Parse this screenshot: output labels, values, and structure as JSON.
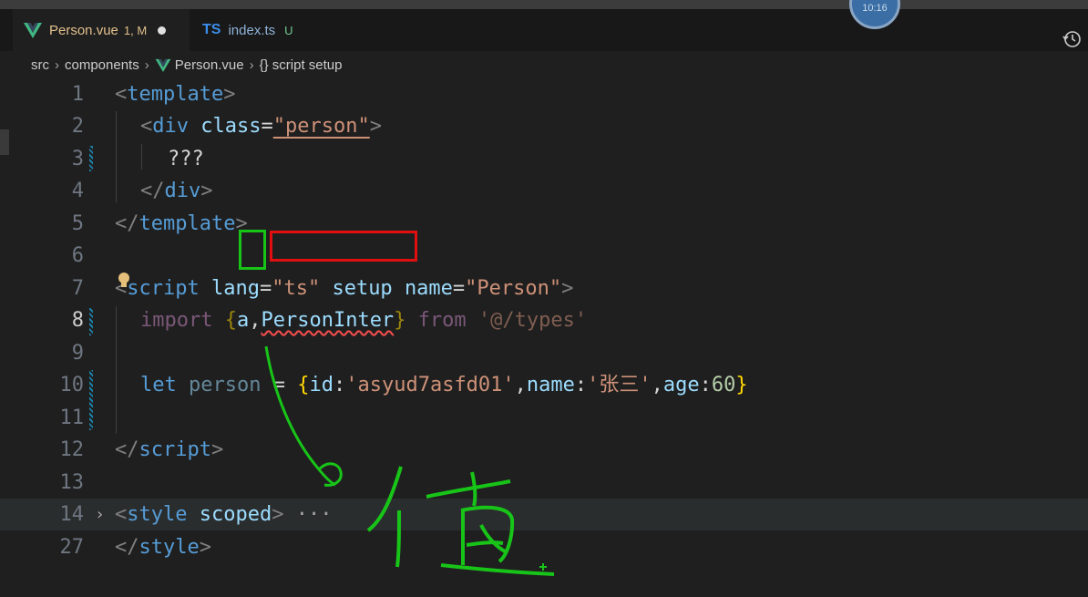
{
  "tabs": [
    {
      "label": "Person.vue",
      "status": "1, M",
      "active": true
    },
    {
      "label": "index.ts",
      "badge": "TS",
      "status": "U",
      "active": false
    }
  ],
  "clock_text": "10:16",
  "breadcrumb": {
    "part1": "src",
    "part2": "components",
    "part3": "Person.vue",
    "part4": "{} script setup"
  },
  "lines": [
    {
      "num": "1"
    },
    {
      "num": "2"
    },
    {
      "num": "3"
    },
    {
      "num": "4"
    },
    {
      "num": "5"
    },
    {
      "num": "6"
    },
    {
      "num": "7"
    },
    {
      "num": "8"
    },
    {
      "num": "9"
    },
    {
      "num": "10"
    },
    {
      "num": "11"
    },
    {
      "num": "12"
    },
    {
      "num": "13"
    },
    {
      "num": "14"
    },
    {
      "num": "27"
    }
  ],
  "code": {
    "l1": {
      "tag": "template"
    },
    "l2": {
      "tag": "div",
      "attr": "class",
      "value": "\"person\""
    },
    "l3": {
      "text": "???"
    },
    "l4": {
      "tag": "div"
    },
    "l5": {
      "tag": "template"
    },
    "l7": {
      "tag": "script",
      "attr1": "lang",
      "val1": "\"ts\"",
      "attr2": "setup",
      "attr3": "name",
      "val3": "\"Person\""
    },
    "l8": {
      "kw": "import",
      "ident1": "a",
      "ident2": "PersonInter",
      "from": "from",
      "path": "'@/types'"
    },
    "l10": {
      "kw": "let",
      "name": "person",
      "op": "=",
      "k1": "id",
      "v1": "'asyud7asfd01'",
      "k2": "name",
      "v2": "'张三'",
      "k3": "age",
      "v3": "60"
    },
    "l12": {
      "tag": "script"
    },
    "l14": {
      "tag": "style",
      "attr": "scoped",
      "ellipsis": "···"
    },
    "l27": {
      "tag": "style"
    }
  },
  "colors": {
    "tag": "#569cd6",
    "attr": "#9cdcfe",
    "string": "#ce9178",
    "keyword": "#c586c0",
    "number": "#b5cea8",
    "brace": "#ffd700",
    "annotation_green": "#18c418",
    "annotation_red": "#e01010"
  },
  "annotation": {
    "handwritten_char": "值"
  }
}
